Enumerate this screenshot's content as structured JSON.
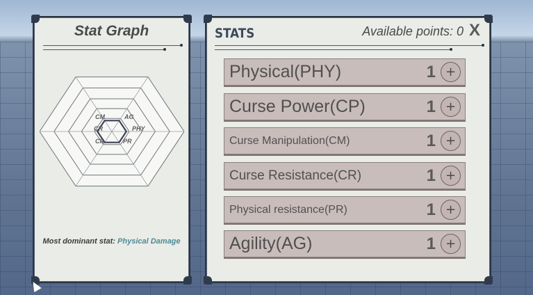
{
  "graph_panel": {
    "title": "Stat Graph",
    "axes": [
      "CM",
      "AG",
      "PHY",
      "PR",
      "CR",
      "CR"
    ],
    "levels": [
      1,
      1,
      1,
      1,
      1,
      1
    ],
    "dominant_label": "Most dominant stat:",
    "dominant_value": "Physical Damage"
  },
  "stats_panel": {
    "title": "STATS",
    "available_label": "Available points: 0",
    "close_label": "X",
    "rows": [
      {
        "name": "Physical(PHY)",
        "value": "1",
        "plus": "+",
        "size": "large"
      },
      {
        "name": "Curse Power(CP)",
        "value": "1",
        "plus": "+",
        "size": "large"
      },
      {
        "name": "Curse Manipulation(CM)",
        "value": "1",
        "plus": "+",
        "size": "small"
      },
      {
        "name": "Curse Resistance(CR)",
        "value": "1",
        "plus": "+",
        "size": "medium"
      },
      {
        "name": "Physical resistance(PR)",
        "value": "1",
        "plus": "+",
        "size": "small"
      },
      {
        "name": "Agility(AG)",
        "value": "1",
        "plus": "+",
        "size": "large"
      }
    ]
  },
  "colors": {
    "panel_bg": "#e9ece7",
    "row_bg": "#c9bdbb",
    "accent_highlight": "#4f8a96",
    "border_dark": "#2a3442"
  }
}
